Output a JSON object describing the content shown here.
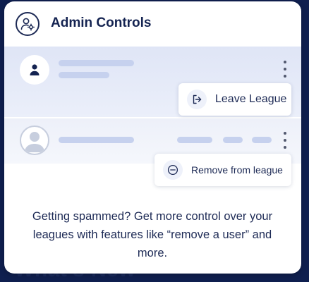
{
  "background": {
    "partial_heading": "What's New"
  },
  "panel": {
    "title": "Admin Controls",
    "header_icon": "user-settings-icon"
  },
  "rows": [
    {
      "avatar_icon": "person-icon",
      "menu_icon": "kebab-menu-icon"
    },
    {
      "avatar_icon": "default-avatar-icon",
      "menu_icon": "kebab-menu-icon"
    }
  ],
  "menus": {
    "leave": {
      "label": "Leave League",
      "icon": "exit-icon"
    },
    "remove": {
      "label": "Remove from league",
      "icon": "minus-circle-icon"
    }
  },
  "description": "Getting spammed? Get more control over your leagues with features like “remove a user” and more.",
  "colors": {
    "accent": "#142351",
    "skeleton": "#c6d1ee",
    "row_highlight": "#dfe5f6",
    "page_background": "#0f1f4f"
  }
}
